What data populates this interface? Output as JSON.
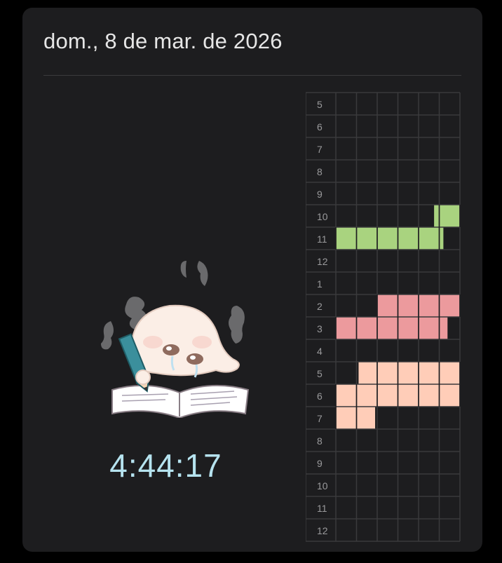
{
  "header": {
    "date_text": "dom., 8 de mar. de 2026"
  },
  "timer": {
    "elapsed": "4:44:17"
  },
  "mascot": {
    "icon": "studying-ghost-icon"
  },
  "timeline": {
    "hour_labels": [
      "5",
      "6",
      "7",
      "8",
      "9",
      "10",
      "11",
      "12",
      "1",
      "2",
      "3",
      "4",
      "5",
      "6",
      "7",
      "8",
      "9",
      "10",
      "11",
      "12"
    ],
    "columns": 6,
    "colors": {
      "green": "#a9d37f",
      "red": "#ec9a9d",
      "peach": "#ffcdb8",
      "grid": "#3a3a3c"
    },
    "blocks": [
      {
        "row": 5,
        "start": 4.75,
        "end": 6.0,
        "color": "green"
      },
      {
        "row": 6,
        "start": 0.0,
        "end": 5.2,
        "color": "green"
      },
      {
        "row": 9,
        "start": 2.0,
        "end": 6.0,
        "color": "red"
      },
      {
        "row": 10,
        "start": 0.0,
        "end": 5.4,
        "color": "red"
      },
      {
        "row": 12,
        "start": 1.1,
        "end": 6.0,
        "color": "peach"
      },
      {
        "row": 13,
        "start": 0.0,
        "end": 6.0,
        "color": "peach"
      },
      {
        "row": 14,
        "start": 0.0,
        "end": 1.9,
        "color": "peach"
      }
    ]
  }
}
